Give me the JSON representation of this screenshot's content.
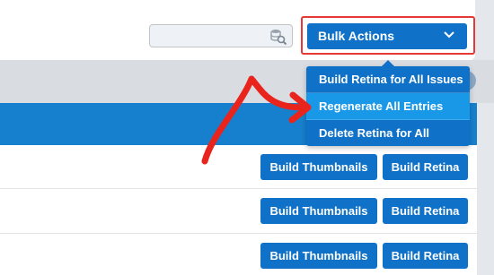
{
  "toolbar": {
    "search_placeholder": "",
    "bulk_actions_label": "Bulk Actions"
  },
  "bulk_menu": {
    "items": [
      {
        "label": "Build Retina for All Issues"
      },
      {
        "label": "Regenerate All Entries"
      },
      {
        "label": "Delete Retina for All"
      }
    ],
    "active_index": 1
  },
  "rows": [
    {
      "thumb_label": "Build Thumbnails",
      "retina_label": "Build Retina"
    },
    {
      "thumb_label": "Build Thumbnails",
      "retina_label": "Build Retina"
    },
    {
      "thumb_label": "Build Thumbnails",
      "retina_label": "Build Retina"
    }
  ],
  "colors": {
    "primary": "#0f72c8",
    "menu_active": "#1a98e8",
    "highlight": "#e53935",
    "header": "#1780ce"
  }
}
